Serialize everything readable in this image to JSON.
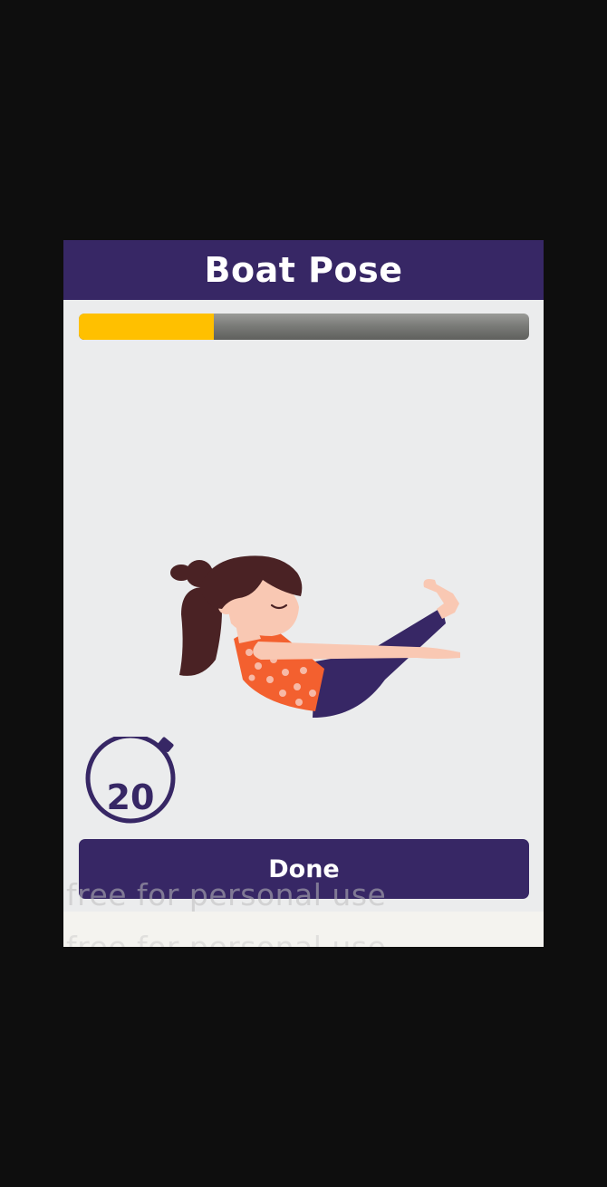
{
  "header": {
    "title": "Boat Pose"
  },
  "progress": {
    "fraction": 0.3
  },
  "illustration": {
    "icon": "boat-pose-woman-illustration"
  },
  "timer": {
    "value": "20",
    "icon": "stopwatch-icon"
  },
  "actions": {
    "done_label": "Done"
  },
  "watermark": {
    "text": "free for personal use"
  },
  "colors": {
    "primary": "#372765",
    "progress_fill": "#ffc000",
    "card_background": "#ebeced",
    "screen_background": "#0e0e0e"
  }
}
